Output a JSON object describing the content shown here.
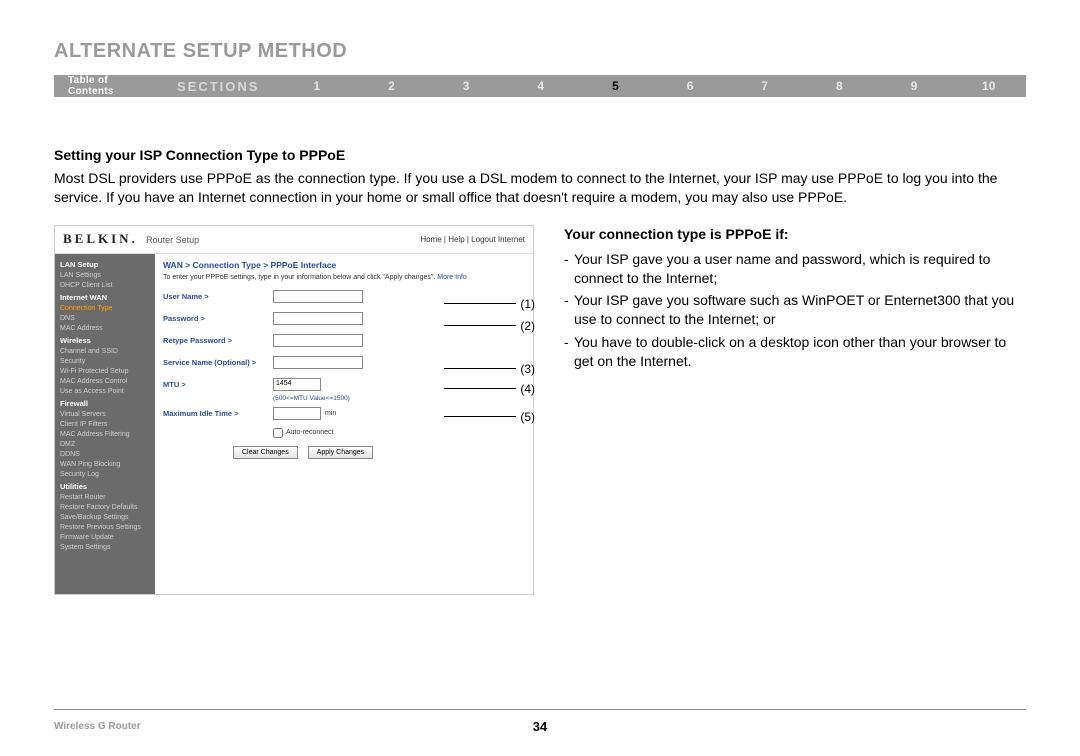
{
  "page_title": "ALTERNATE SETUP METHOD",
  "nav": {
    "toc": "Table of Contents",
    "sections_label": "SECTIONS",
    "numbers": [
      "1",
      "2",
      "3",
      "4",
      "5",
      "6",
      "7",
      "8",
      "9",
      "10"
    ],
    "active": "5"
  },
  "intro": {
    "heading": "Setting your ISP Connection Type to PPPoE",
    "text": "Most DSL providers use PPPoE as the connection type. If you use a DSL modem to connect to the Internet, your ISP may use PPPoE to log you into the service. If you have an Internet connection in your home or small office that doesn't require a modem, you may also use PPPoE."
  },
  "right": {
    "heading": "Your connection type is PPPoE if:",
    "bullets": [
      "Your ISP gave you a user name and password, which is required to connect to the Internet;",
      "Your ISP gave you software such as WinPOET or Enternet300 that you use to connect to the Internet; or",
      "You have to double-click on a desktop icon other than your browser to get on the Internet."
    ]
  },
  "router": {
    "brand": "BELKIN.",
    "brand_sub": "Router Setup",
    "top_links": "Home | Help | Logout  Internet",
    "breadcrumb": "WAN > Connection Type > PPPoE Interface",
    "instruction": "To enter your PPPoE settings, type in your information below and click \"Apply changes\".",
    "more_info": "More Info",
    "sidebar": {
      "groups": [
        {
          "cat": "LAN Setup",
          "items": [
            "LAN Settings",
            "DHCP Client List"
          ]
        },
        {
          "cat": "Internet WAN",
          "highlight": true,
          "items": [
            "Connection Type",
            "DNS",
            "MAC Address"
          ]
        },
        {
          "cat": "Wireless",
          "items": [
            "Channel and SSID",
            "Security",
            "Wi-Fi Protected Setup",
            "MAC Address Control",
            "Use as Access Point"
          ]
        },
        {
          "cat": "Firewall",
          "items": [
            "Virtual Servers",
            "Client IP Filters",
            "MAC Address Filtering",
            "DMZ",
            "DDNS",
            "WAN Ping Blocking",
            "Security Log"
          ]
        },
        {
          "cat": "Utilities",
          "items": [
            "Restart Router",
            "Restore Factory Defaults",
            "Save/Backup Settings",
            "Restore Previous Settings",
            "Firmware Update",
            "System Settings"
          ]
        }
      ]
    },
    "form": {
      "username": "User Name >",
      "password": "Password >",
      "retype": "Retype Password >",
      "service": "Service Name (Optional) >",
      "mtu": "MTU >",
      "mtu_value": "1454",
      "mtu_hint": "(500<=MTU Value<=1500)",
      "idle": "Maximum Idle Time >",
      "min": "min",
      "auto": "Auto-reconnect",
      "clear_btn": "Clear Changes",
      "apply_btn": "Apply Changes"
    },
    "callouts": [
      "(1)",
      "(2)",
      "(3)",
      "(4)",
      "(5)"
    ]
  },
  "footer": {
    "left": "Wireless G Router",
    "page": "34"
  }
}
